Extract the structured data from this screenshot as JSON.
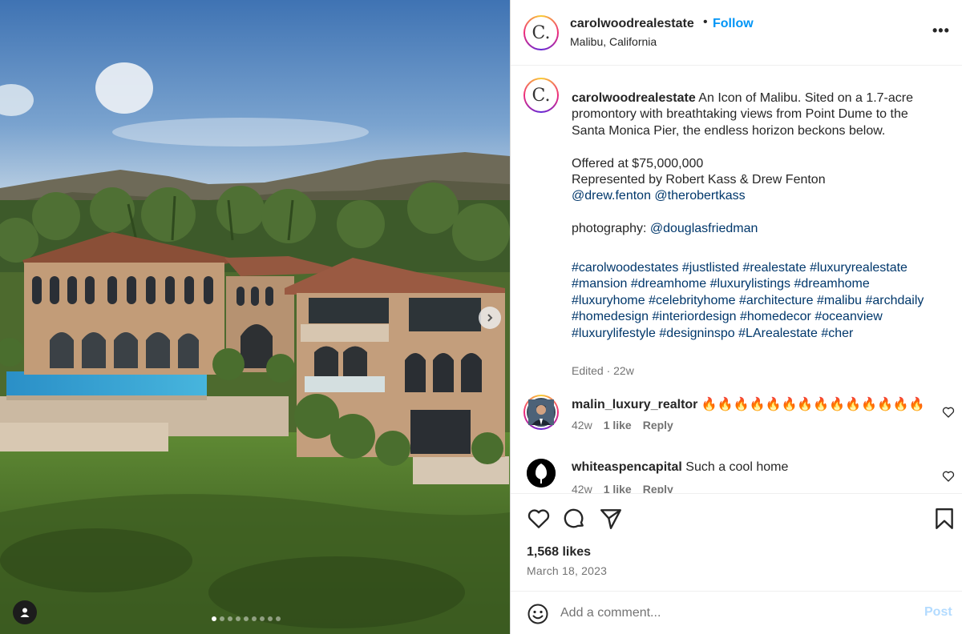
{
  "post": {
    "author": {
      "username": "carolwoodrealestate",
      "avatar_letter": "C.",
      "location": "Malibu, California",
      "follow_label": "Follow",
      "separator": "•"
    },
    "more_icon": "more-options-icon",
    "more_label": "•••",
    "carousel": {
      "slide_count": 9,
      "active_index": 0
    },
    "caption": {
      "username": "carolwoodrealestate",
      "line1": " An Icon of Malibu. Sited on a 1.7-acre promontory with breathtaking views from Point Dume to the Santa Monica Pier, the endless horizon beckons below.",
      "offered": "Offered at $75,000,000",
      "represented": "Represented by Robert Kass & Drew Fenton",
      "mention1": "@drew.fenton",
      "mention2": "@therobertkass",
      "photo_prefix": "photography: ",
      "photo_mention": "@douglasfriedman",
      "hashtags": [
        "#carolwoodestates",
        "#justlisted",
        "#realestate",
        "#luxuryrealestate",
        "#mansion",
        "#dreamhome",
        "#luxurylistings",
        "#dreamhome",
        "#luxuryhome",
        "#celebrityhome",
        "#architecture",
        "#malibu",
        "#archdaily",
        "#homedesign",
        "#interiordesign",
        "#homedecor",
        "#oceanview",
        "#luxurylifestyle",
        "#designinspo",
        "#LArealestate",
        "#cher"
      ],
      "edited": "Edited · 22w"
    },
    "comments": [
      {
        "username": "malin_luxury_realtor",
        "text": " 🔥🔥🔥🔥🔥🔥🔥🔥🔥🔥🔥🔥🔥🔥",
        "age": "42w",
        "likes": "1 like",
        "reply": "Reply"
      },
      {
        "username": "whiteaspencapital",
        "text": " Such a cool home",
        "age": "42w",
        "likes": "1 like",
        "reply": "Reply"
      }
    ],
    "likes": "1,568 likes",
    "date": "March 18, 2023",
    "add_comment": {
      "placeholder": "Add a comment...",
      "post_label": "Post"
    }
  },
  "colors": {
    "link_blue": "#0095f6",
    "mention": "#00376b",
    "muted": "#737373",
    "post_disabled": "#b3dbff"
  }
}
